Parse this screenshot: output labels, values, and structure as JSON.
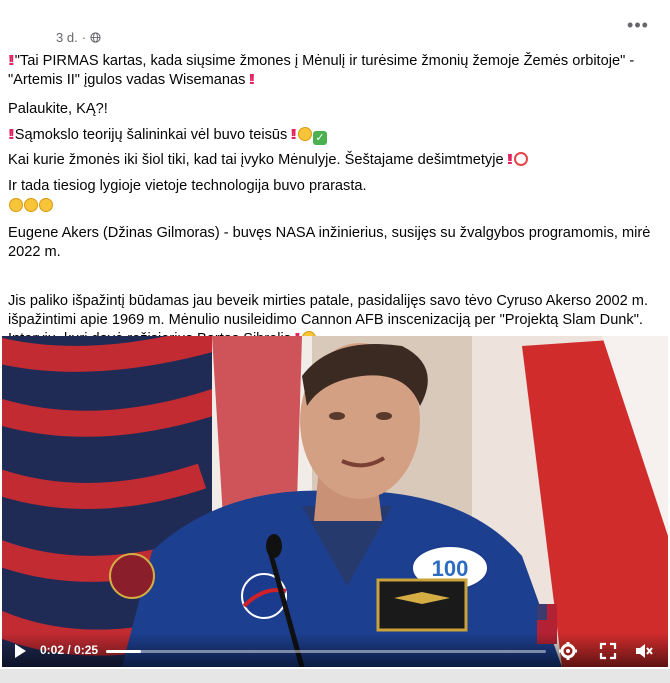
{
  "post": {
    "timestamp": "3 d.",
    "visibility_icon": "globe-icon",
    "more_icon": "more-horizontal-icon",
    "body": {
      "p1": "\"Tai PIRMAS kartas, kada siųsime žmones į Mėnulį ir turėsime žmonių žemoje Žemės orbitoje\" - \"Artemis II\" įgulos vadas Wisemanas",
      "p2": "Palaukite, KĄ?!",
      "p3": "Sąmokslo teorijų šalininkai vėl buvo teisūs",
      "p4": "Kai kurie žmonės iki šiol tiki, kad tai įvyko Mėnulyje. Šeštajame dešimtmetyje",
      "p5": "Ir tada tiesiog lygioje vietoje technologija buvo prarasta.",
      "p6": "Eugene Akers (Džinas Gilmoras) - buvęs NASA inžinierius, susijęs su žvalgybos programomis, mirė 2022 m.",
      "p7": "Jis paliko išpažintį būdamas jau beveik mirties patale, pasidalijęs savo tėvo Cyruso Akerso 2002 m. išpažintimi apie 1969 m. Mėnulio nusileidimo Cannon AFB inscenizaciją per \"Projektą Slam Dunk\". Interviu, kurį davė režisierius Bartas Sibrelis"
    }
  },
  "video": {
    "patch_text": "100",
    "current_time": "0:02",
    "duration": "0:25",
    "time_display": "0:02 / 0:25",
    "progress_fraction": 0.08,
    "icons": [
      "play-icon",
      "settings-icon",
      "fullscreen-icon",
      "volume-icon"
    ]
  },
  "colors": {
    "text": "#050505",
    "meta": "#65676b",
    "bang": "#e0245e"
  }
}
